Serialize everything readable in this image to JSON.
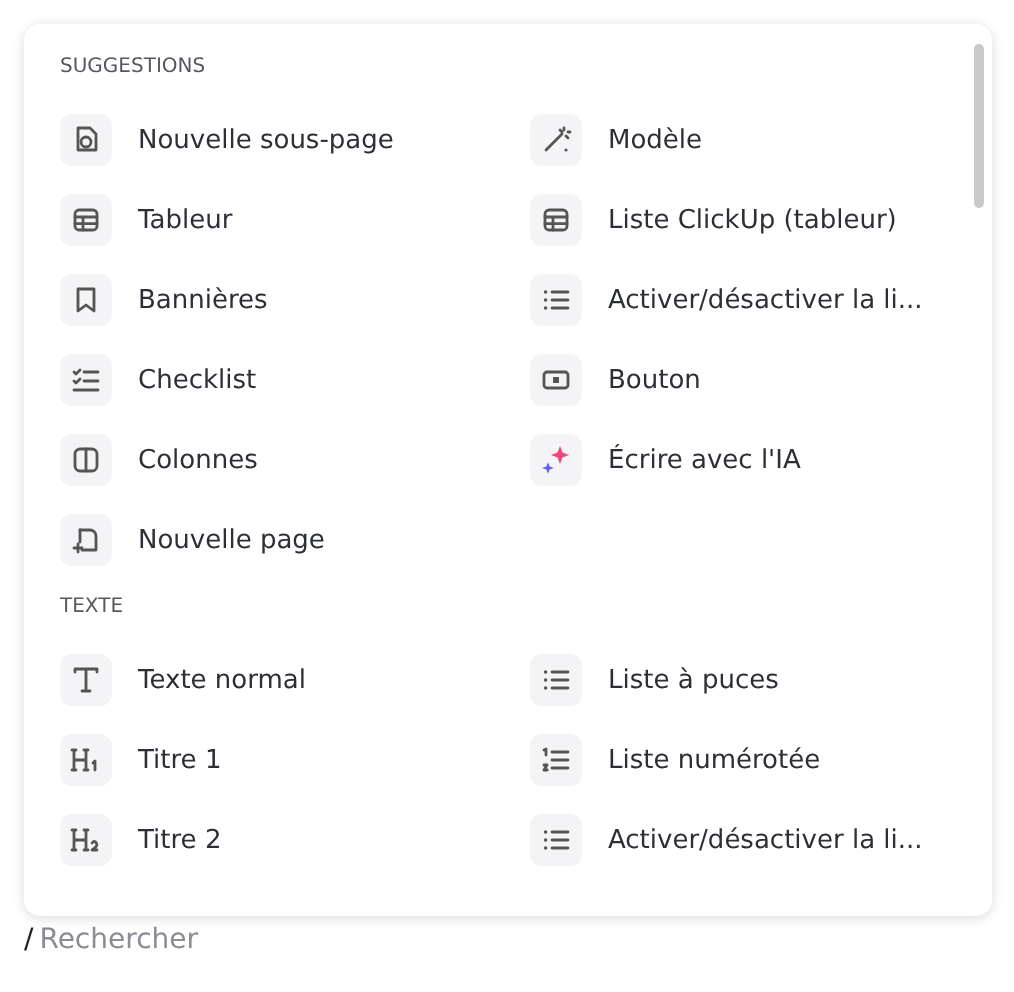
{
  "menu": {
    "sections": [
      {
        "title": "SUGGESTIONS",
        "items": [
          {
            "label": "Nouvelle sous-page",
            "kind": "subpage"
          },
          {
            "label": "Modèle",
            "kind": "template"
          },
          {
            "label": "Tableur",
            "kind": "table"
          },
          {
            "label": "Liste ClickUp (tableur)",
            "kind": "table"
          },
          {
            "label": "Bannières",
            "kind": "bookmark"
          },
          {
            "label": "Activer/désactiver la li...",
            "kind": "list"
          },
          {
            "label": "Checklist",
            "kind": "checklist"
          },
          {
            "label": "Bouton",
            "kind": "button"
          },
          {
            "label": "Colonnes",
            "kind": "columns"
          },
          {
            "label": "Écrire avec l'IA",
            "kind": "ai"
          },
          {
            "label": "Nouvelle page",
            "kind": "newpage"
          }
        ]
      },
      {
        "title": "TEXTE",
        "items": [
          {
            "label": "Texte normal",
            "kind": "text"
          },
          {
            "label": "Liste à puces",
            "kind": "list"
          },
          {
            "label": "Titre 1",
            "kind": "h1"
          },
          {
            "label": "Liste numérotée",
            "kind": "numbered"
          },
          {
            "label": "Titre 2",
            "kind": "h2"
          },
          {
            "label": "Activer/désactiver la li...",
            "kind": "list"
          }
        ]
      }
    ]
  },
  "command_input": {
    "value": "/",
    "placeholder": "Rechercher"
  }
}
